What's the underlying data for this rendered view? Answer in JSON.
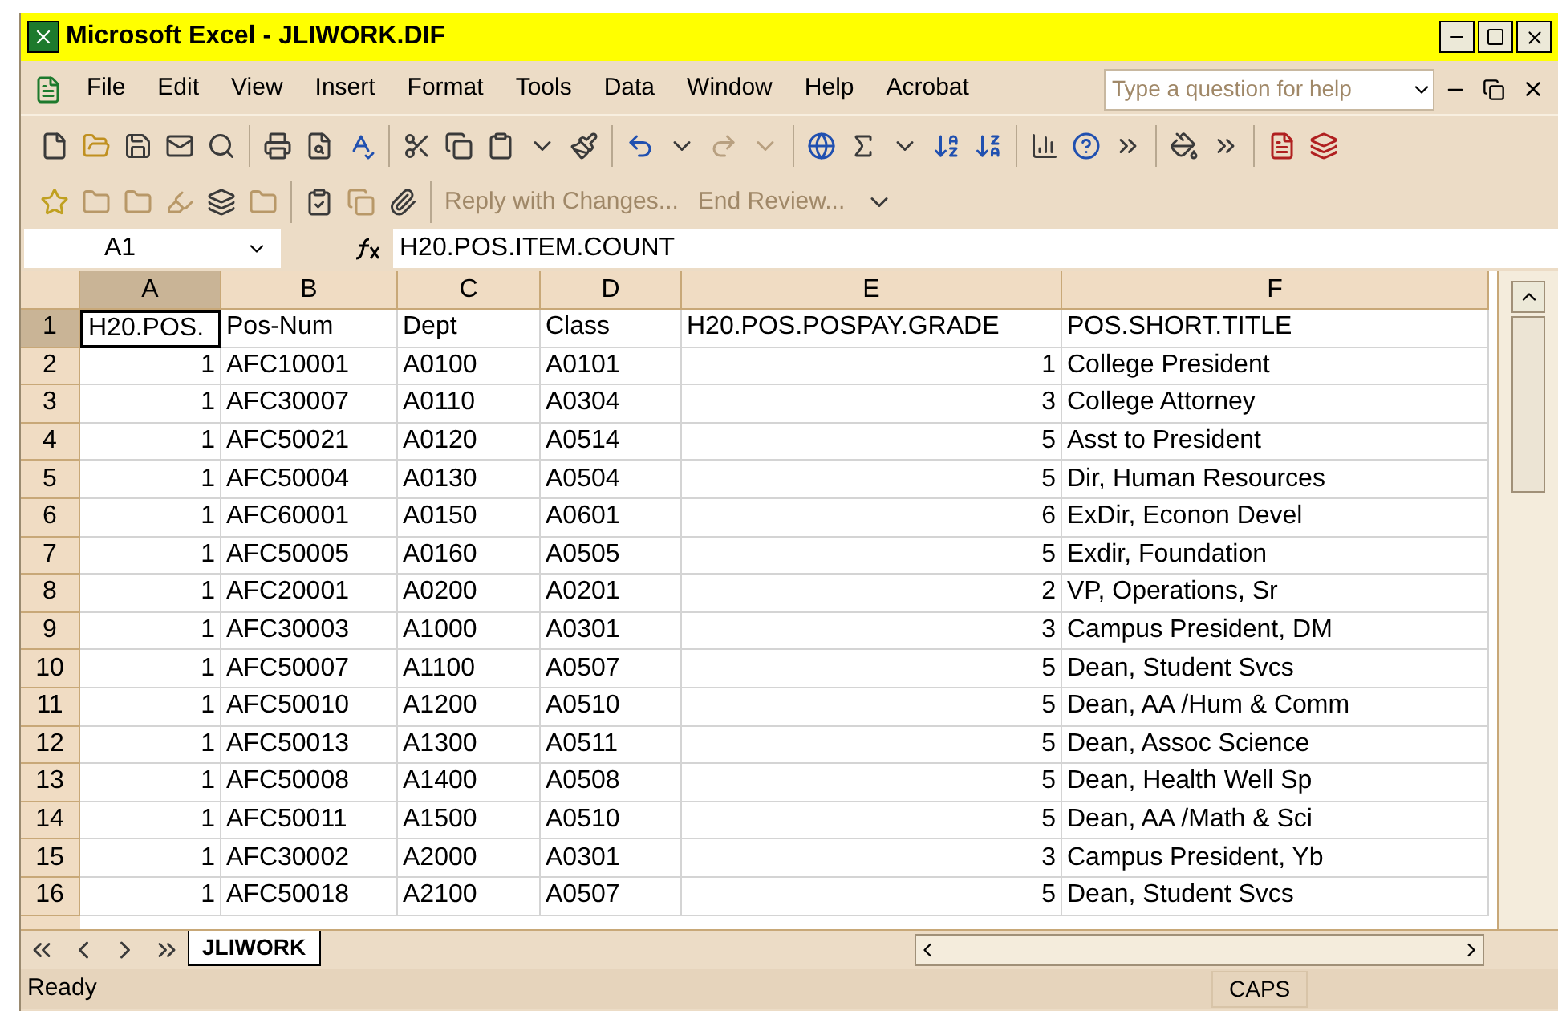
{
  "window": {
    "title": "Microsoft Excel - JLIWORK.DIF"
  },
  "menu": [
    "File",
    "Edit",
    "View",
    "Insert",
    "Format",
    "Tools",
    "Data",
    "Window",
    "Help",
    "Acrobat"
  ],
  "help_search": {
    "placeholder": "Type a question for help"
  },
  "review_toolbar": {
    "reply": "Reply with Changes...",
    "end": "End Review..."
  },
  "formula_bar": {
    "name_box": "A1",
    "formula": "H20.POS.ITEM.COUNT"
  },
  "sheet": {
    "columns": [
      {
        "label": "A",
        "numeric": true,
        "selected": true
      },
      {
        "label": "B",
        "numeric": false,
        "selected": false
      },
      {
        "label": "C",
        "numeric": false,
        "selected": false
      },
      {
        "label": "D",
        "numeric": false,
        "selected": false
      },
      {
        "label": "E",
        "numeric": true,
        "selected": false
      },
      {
        "label": "F",
        "numeric": false,
        "selected": false
      }
    ],
    "rows": [
      {
        "number": "1",
        "selected": true,
        "cells": [
          {
            "text": "H20.POS.",
            "active": true
          },
          {
            "text": "Pos-Num",
            "active": false
          },
          {
            "text": "Dept",
            "active": false
          },
          {
            "text": "Class",
            "active": false
          },
          {
            "text": "H20.POS.POSPAY.GRADE",
            "active": false
          },
          {
            "text": "POS.SHORT.TITLE",
            "active": false
          }
        ]
      },
      {
        "number": "2",
        "selected": false,
        "cells": [
          "1",
          "AFC10001",
          "A0100",
          "A0101",
          "1",
          "College President"
        ]
      },
      {
        "number": "3",
        "selected": false,
        "cells": [
          "1",
          "AFC30007",
          "A0110",
          "A0304",
          "3",
          "College Attorney"
        ]
      },
      {
        "number": "4",
        "selected": false,
        "cells": [
          "1",
          "AFC50021",
          "A0120",
          "A0514",
          "5",
          "Asst to President"
        ]
      },
      {
        "number": "5",
        "selected": false,
        "cells": [
          "1",
          "AFC50004",
          "A0130",
          "A0504",
          "5",
          "Dir, Human Resources"
        ]
      },
      {
        "number": "6",
        "selected": false,
        "cells": [
          "1",
          "AFC60001",
          "A0150",
          "A0601",
          "6",
          "ExDir, Econon Devel"
        ]
      },
      {
        "number": "7",
        "selected": false,
        "cells": [
          "1",
          "AFC50005",
          "A0160",
          "A0505",
          "5",
          "Exdir, Foundation"
        ]
      },
      {
        "number": "8",
        "selected": false,
        "cells": [
          "1",
          "AFC20001",
          "A0200",
          "A0201",
          "2",
          "VP, Operations, Sr"
        ]
      },
      {
        "number": "9",
        "selected": false,
        "cells": [
          "1",
          "AFC30003",
          "A1000",
          "A0301",
          "3",
          "Campus President, DM"
        ]
      },
      {
        "number": "10",
        "selected": false,
        "cells": [
          "1",
          "AFC50007",
          "A1100",
          "A0507",
          "5",
          "Dean, Student Svcs"
        ]
      },
      {
        "number": "11",
        "selected": false,
        "cells": [
          "1",
          "AFC50010",
          "A1200",
          "A0510",
          "5",
          "Dean, AA /Hum & Comm"
        ]
      },
      {
        "number": "12",
        "selected": false,
        "cells": [
          "1",
          "AFC50013",
          "A1300",
          "A0511",
          "5",
          "Dean, Assoc Science"
        ]
      },
      {
        "number": "13",
        "selected": false,
        "cells": [
          "1",
          "AFC50008",
          "A1400",
          "A0508",
          "5",
          "Dean, Health Well Sp"
        ]
      },
      {
        "number": "14",
        "selected": false,
        "cells": [
          "1",
          "AFC50011",
          "A1500",
          "A0510",
          "5",
          "Dean, AA /Math & Sci"
        ]
      },
      {
        "number": "15",
        "selected": false,
        "cells": [
          "1",
          "AFC30002",
          "A2000",
          "A0301",
          "3",
          "Campus President, Yb"
        ]
      },
      {
        "number": "16",
        "selected": false,
        "cells": [
          "1",
          "AFC50018",
          "A2100",
          "A0507",
          "5",
          "Dean, Student Svcs"
        ]
      }
    ]
  },
  "sheet_tabs": [
    {
      "label": "JLIWORK",
      "selected": true
    }
  ],
  "status_bar": {
    "status": "Ready",
    "indicators": [
      "CAPS"
    ]
  }
}
